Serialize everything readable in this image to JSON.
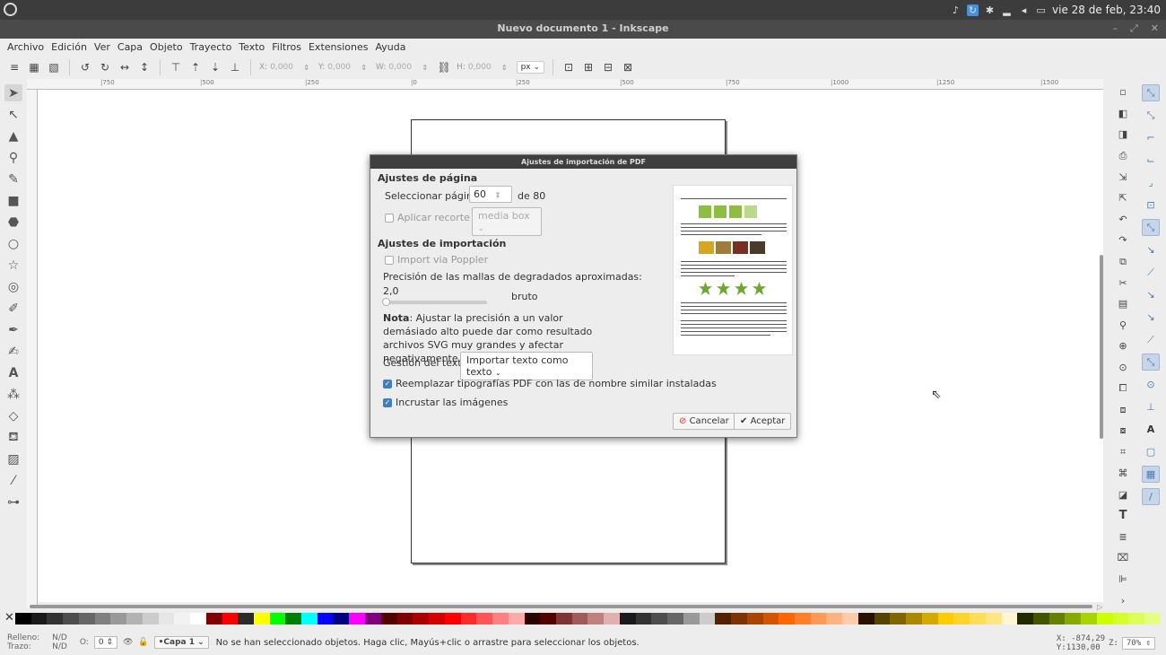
{
  "system": {
    "datetime": "vie 28 de feb, 23:40"
  },
  "window": {
    "title": "Nuevo documento 1 - Inkscape"
  },
  "menu": [
    "Archivo",
    "Edición",
    "Ver",
    "Capa",
    "Objeto",
    "Trayecto",
    "Texto",
    "Filtros",
    "Extensiones",
    "Ayuda"
  ],
  "toolbar": {
    "x_label": "X:",
    "x_value": "0,000",
    "y_label": "Y:",
    "y_value": "0,000",
    "w_label": "W:",
    "w_value": "0,000",
    "h_label": "H:",
    "h_value": "0,000",
    "unit": "px"
  },
  "ruler": {
    "marks": [
      "|750",
      "|500",
      "|250",
      "|0",
      "|250",
      "|500",
      "|750",
      "|1000",
      "|1250",
      "|1500"
    ]
  },
  "dialog": {
    "title": "Ajustes de importación de PDF",
    "page_settings_heading": "Ajustes de página",
    "select_page_label": "Seleccionar página",
    "page_value": "60",
    "page_of": "de 80",
    "clip_label": "Aplicar recorte a:",
    "clip_value": "media box",
    "import_settings_heading": "Ajustes de importación",
    "poppler_label": "Import via Poppler",
    "mesh_label": "Precisión de las mallas de degradados aproximadas:",
    "mesh_value": "2,0",
    "mesh_level": 0,
    "rough_label": "bruto",
    "note_bold": "Nota",
    "note_text": ": Ajustar la precisión a un valor demásiado alto puede dar como resultado archivos SVG muy grandes y afectar negativamente al rendimiento.",
    "text_handling_label": "Gestión del texto:",
    "text_handling_value": "Importar texto como texto",
    "replace_fonts_label": "Reemplazar tipografías PDF con las de nombre similar instaladas",
    "embed_images_label": "Incrustar las imágenes",
    "cancel_label": "Cancelar",
    "accept_label": "Aceptar"
  },
  "status": {
    "fill_label": "Relleno:",
    "stroke_label": "Trazo:",
    "fill_value": "N/D",
    "stroke_value": "N/D",
    "opacity_label": "O:",
    "opacity_value": "0",
    "layer": "•Capa 1",
    "message": "No se han seleccionado objetos. Haga clic, Mayús+clic o arrastre para seleccionar los objetos.",
    "x_coord": "X: -874,29",
    "y_coord": "Y:1130,00",
    "zoom_label": "Z:",
    "zoom_value": "70%"
  },
  "colors": {
    "accent": "#3f7fbf",
    "palette": [
      "#000000",
      "#1a1a1a",
      "#333333",
      "#4d4d4d",
      "#666666",
      "#808080",
      "#999999",
      "#b3b3b3",
      "#cccccc",
      "#e6e6e6",
      "#f2f2f2",
      "#ffffff",
      "#800000",
      "#ff0000",
      "#2b2b2b",
      "#ffff00",
      "#00ff00",
      "#008000",
      "#00ffff",
      "#0000ff",
      "#000080",
      "#ff00ff",
      "#800080",
      "#550000",
      "#800000",
      "#aa0000",
      "#d40000",
      "#ff0000",
      "#ff2a2a",
      "#ff5555",
      "#ff8080",
      "#ffaaaa",
      "#2b0000",
      "#550000",
      "#803333",
      "#a05a5a",
      "#c08080",
      "#e0b0b0",
      "#1a1a1a",
      "#333333",
      "#4d4d4d",
      "#666666",
      "#999999",
      "#cccccc",
      "#552200",
      "#803300",
      "#aa4400",
      "#d45500",
      "#ff6600",
      "#ff7f2a",
      "#ff9955",
      "#ffb380",
      "#ffccaa",
      "#2b1100",
      "#554400",
      "#806600",
      "#aa8800",
      "#d4aa00",
      "#ffcc00",
      "#ffd42a",
      "#ffdd55",
      "#ffe680",
      "#fff6d5",
      "#222b00",
      "#445500",
      "#668000",
      "#88aa00",
      "#aad400",
      "#ccff00",
      "#d4ff2a",
      "#ddff55",
      "#e5ff80"
    ]
  }
}
